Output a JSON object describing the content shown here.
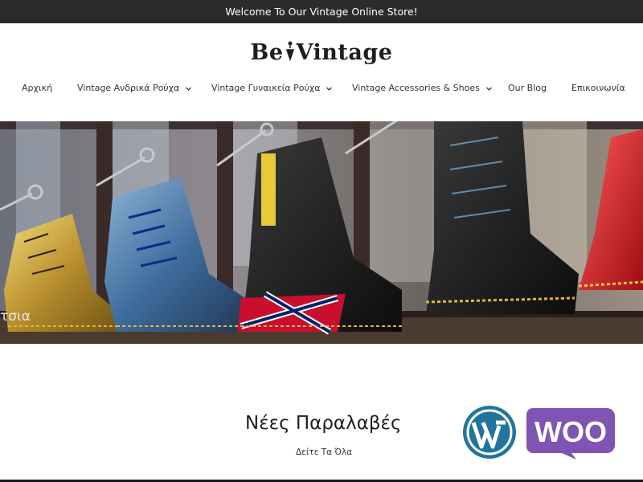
{
  "topbar": {
    "welcome": "Welcome To Our Vintage Online Store!"
  },
  "brand": {
    "part1": "Be",
    "part2": "Vintage"
  },
  "nav": {
    "items": [
      {
        "label": "Αρχική",
        "has_dropdown": false
      },
      {
        "label": "Vintage Ανδρικά Ρούχα",
        "has_dropdown": true
      },
      {
        "label": "Vintage Γυναικεία Ρούχα",
        "has_dropdown": true
      },
      {
        "label": "Vintage Accessories & Shoes",
        "has_dropdown": true
      },
      {
        "label": "Our Blog",
        "has_dropdown": false
      },
      {
        "label": "Επικοινωνία",
        "has_dropdown": false
      }
    ]
  },
  "hero": {
    "caption": "τσια"
  },
  "section": {
    "title": "Νέες Παραλαβές",
    "see_all": "Δείτε Τα Όλα"
  },
  "badges": {
    "woo_text": "WOO"
  },
  "colors": {
    "topbar_bg": "#2b2b2b",
    "woo_purple": "#7f54b3",
    "wp_blue": "#21759b"
  }
}
